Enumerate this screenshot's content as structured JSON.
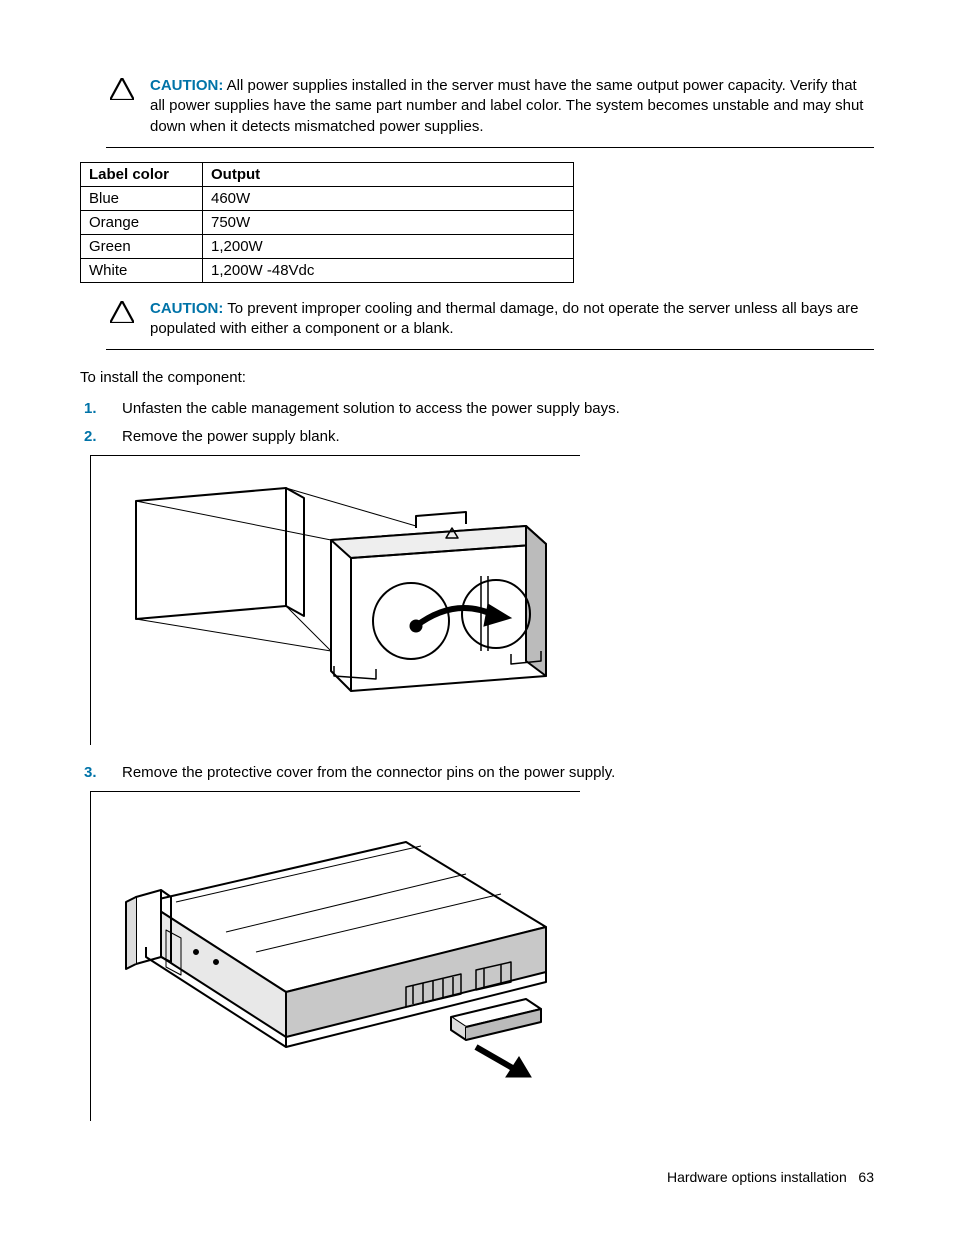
{
  "caution1": {
    "label": "CAUTION:",
    "text": "All power supplies installed in the server must have the same output power capacity. Verify that all power supplies have the same part number and label color. The system becomes unstable and may shut down when it detects mismatched power supplies."
  },
  "table": {
    "headers": [
      "Label color",
      "Output"
    ],
    "rows": [
      [
        "Blue",
        "460W"
      ],
      [
        "Orange",
        "750W"
      ],
      [
        "Green",
        "1,200W"
      ],
      [
        "White",
        "1,200W -48Vdc"
      ]
    ]
  },
  "caution2": {
    "label": "CAUTION:",
    "text": "To prevent improper cooling and thermal damage, do not operate the server unless all bays are populated with either a component or a blank."
  },
  "intro": "To install the component:",
  "steps": {
    "s1": {
      "num": "1.",
      "text": "Unfasten the cable management solution to access the power supply bays."
    },
    "s2": {
      "num": "2.",
      "text": "Remove the power supply blank."
    },
    "s3": {
      "num": "3.",
      "text": "Remove the protective cover from the connector pins on the power supply."
    }
  },
  "footer": {
    "section": "Hardware options installation",
    "page": "63"
  }
}
